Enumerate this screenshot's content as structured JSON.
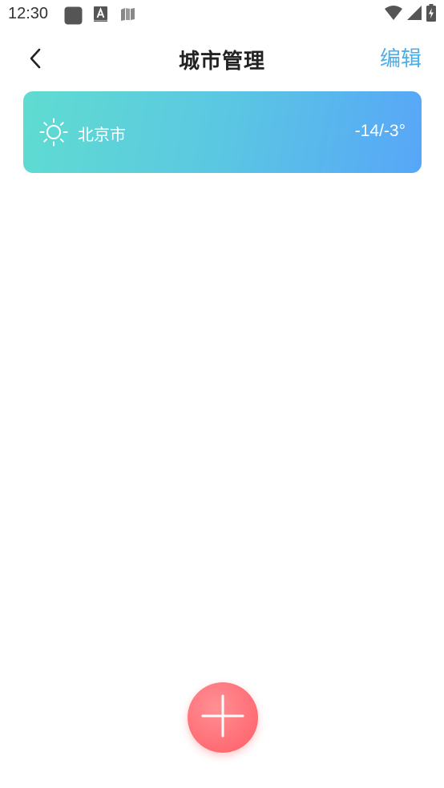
{
  "status_bar": {
    "time": "12:30",
    "left_icons": [
      "app-icon",
      "font-icon",
      "book-icon"
    ],
    "right_icons": [
      "wifi-icon",
      "signal-icon",
      "battery-icon"
    ]
  },
  "header": {
    "back_icon": "chevron-left-icon",
    "title": "城市管理",
    "edit_label": "编辑"
  },
  "cities": [
    {
      "name": "北京市",
      "temperature": "-14/-3°",
      "weather_icon": "sun-icon"
    }
  ],
  "add_button": {
    "icon": "plus-icon"
  },
  "colors": {
    "accent": "#4aaee8",
    "card_gradient_start": "#5fdcd1",
    "card_gradient_end": "#57a6f8",
    "add_button": "#ff6c74"
  }
}
